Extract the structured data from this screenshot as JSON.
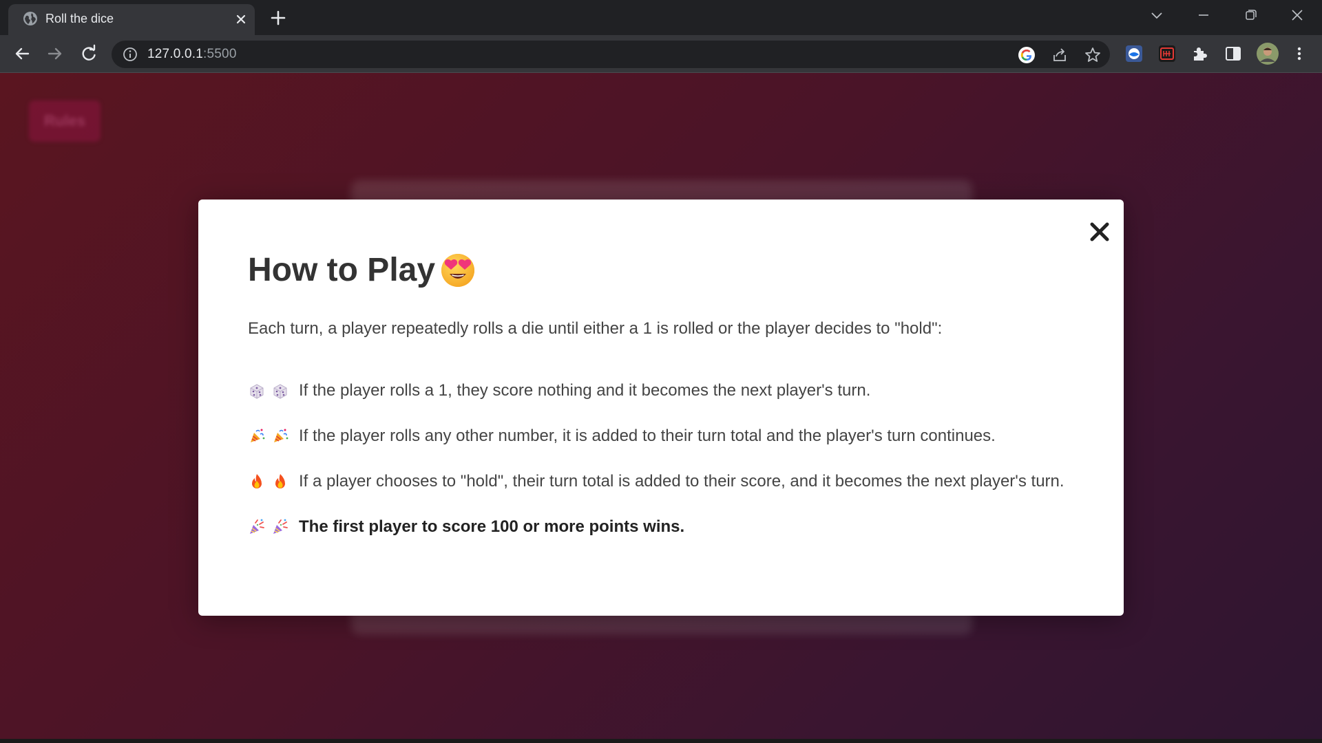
{
  "browser": {
    "tab_title": "Roll the dice",
    "url_host": "127.0.0.1",
    "url_port": ":5500"
  },
  "page": {
    "rules_button_label": "Rules"
  },
  "modal": {
    "title": "How to Play",
    "title_emoji": "heart-eyes-emoji",
    "intro": "Each turn, a player repeatedly rolls a die until either a 1 is rolled or the player decides to \"hold\":",
    "rules": [
      {
        "emoji": "dice-icon",
        "text": "If the player rolls a 1, they score nothing and it becomes the next player's turn."
      },
      {
        "emoji": "party-popper-icon",
        "text": "If the player rolls any other number, it is added to their turn total and the player's turn continues."
      },
      {
        "emoji": "fire-icon",
        "text": "If a player chooses to \"hold\", their turn total is added to their score, and it becomes the next player's turn."
      },
      {
        "emoji": "confetti-icon",
        "text": "The first player to score 100 or more points wins."
      }
    ]
  },
  "colors": {
    "page_gradient_start": "#5a1520",
    "page_gradient_end": "#2e1530",
    "modal_bg": "#ffffff",
    "text": "#444444"
  }
}
